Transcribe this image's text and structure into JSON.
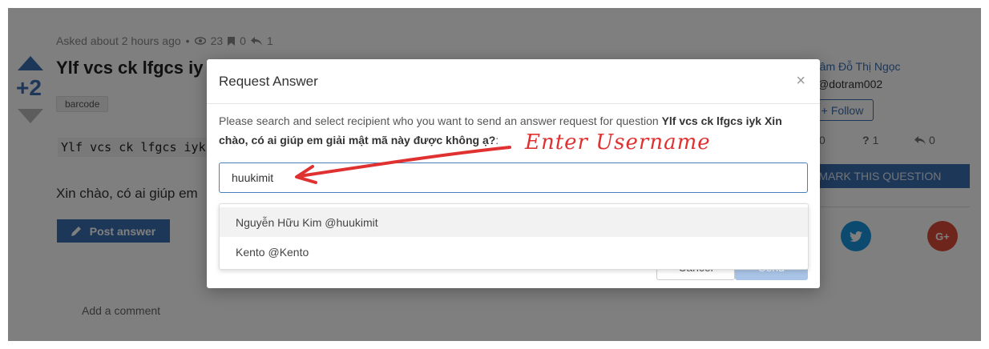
{
  "question": {
    "meta": {
      "asked": "Asked about 2 hours ago",
      "views": "23",
      "bookmarks": "0",
      "shares": "1"
    },
    "score": "+2",
    "title": "Ylf vcs ck lfgcs iy",
    "tag": "barcode",
    "code": "Ylf vcs ck lfgcs iyk",
    "body": "Xin chào, có ai giúp em",
    "post_answer_label": "Post answer",
    "add_comment_label": "Add a comment"
  },
  "sidebar": {
    "author_name": "râm Đỗ Thị Ngọc",
    "author_handle": "@dotram002",
    "follow_label": "Follow",
    "stats": {
      "bookmarks": "0",
      "questions": "1",
      "shares": "0"
    },
    "bookmark_label": "KMARK THIS QUESTION",
    "social": {
      "twitter_color": "#1b95e0",
      "gplus_color": "#dd4b39"
    }
  },
  "modal": {
    "title": "Request Answer",
    "close_symbol": "×",
    "desc_prefix": "Please search and select recipient who you want to send an answer request for question ",
    "desc_question": "Ylf vcs ck lfgcs iyk Xin chào, có ai giúp em giải mật mã này được không ạ?",
    "desc_suffix": ":",
    "search_value": "huukimit",
    "cancel_label": "Cancel",
    "send_label": "Send"
  },
  "dropdown": {
    "items": [
      {
        "label": "Nguyễn Hữu Kim @huukimit"
      },
      {
        "label": "Kento @Kento"
      }
    ]
  },
  "annotation": {
    "text": "Enter Username",
    "color": "#e03131"
  },
  "colors": {
    "primary": "#3b6fb0",
    "overlay": "rgba(0,0,0,0.5)"
  }
}
